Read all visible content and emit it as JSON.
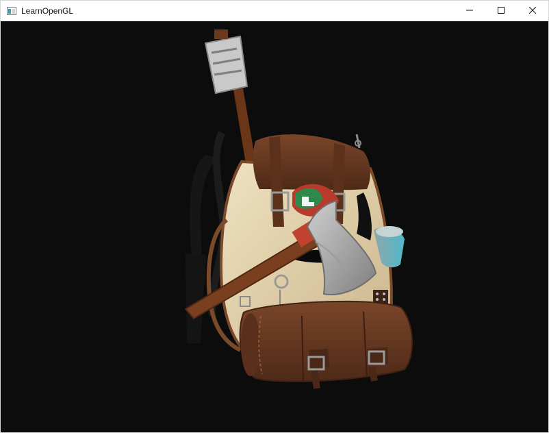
{
  "window": {
    "title": "LearnOpenGL",
    "app_icon": "window-app-icon",
    "controls": {
      "minimize_icon": "minimize-icon",
      "maximize_icon": "maximize-icon",
      "close_icon": "close-icon"
    }
  },
  "viewport": {
    "background": "#0c0c0c",
    "render": "backpack-model"
  },
  "colors": {
    "leather": "#6a3b22",
    "canvas": "#e3d2ad",
    "axe_blade": "#a9a9a9",
    "handle": "#7a3f1f",
    "straps": "#1b1b1b"
  }
}
